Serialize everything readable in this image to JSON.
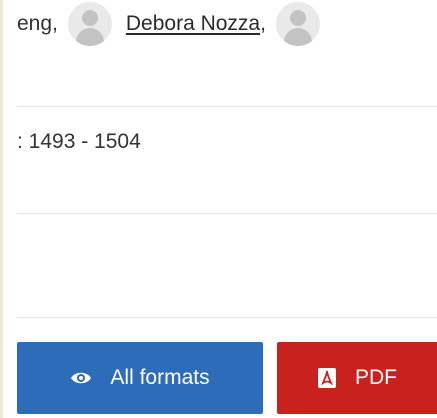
{
  "authors": {
    "partial_name": "eng,",
    "second_name": "Debora Nozza",
    "separator": ","
  },
  "pages": {
    "text": ": 1493 - 1504"
  },
  "buttons": {
    "all_formats": "All formats",
    "pdf": "PDF"
  },
  "icons": {
    "all_formats": "eye-icon",
    "pdf": "pdf-icon"
  },
  "colors": {
    "all_formats_bg": "#2d6cb8",
    "pdf_bg": "#c9211d"
  }
}
